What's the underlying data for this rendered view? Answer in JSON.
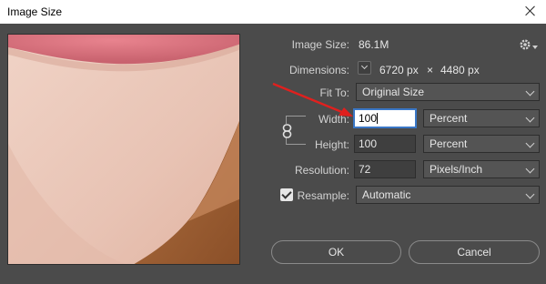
{
  "window": {
    "title": "Image Size"
  },
  "image_size": {
    "label": "Image Size:",
    "value": "86.1M"
  },
  "dimensions": {
    "label": "Dimensions:",
    "width_value": "6720 px",
    "times": "×",
    "height_value": "4480 px"
  },
  "fit_to": {
    "label": "Fit To:",
    "selected": "Original Size"
  },
  "width": {
    "label": "Width:",
    "value": "100",
    "unit": "Percent"
  },
  "height": {
    "label": "Height:",
    "value": "100",
    "unit": "Percent"
  },
  "resolution": {
    "label": "Resolution:",
    "value": "72",
    "unit": "Pixels/Inch"
  },
  "resample": {
    "label": "Resample:",
    "checked": true,
    "selected": "Automatic"
  },
  "buttons": {
    "ok": "OK",
    "cancel": "Cancel"
  },
  "colors": {
    "dialog_bg": "#4b4b4b",
    "annotation_arrow": "#e0201e",
    "focus_border": "#3a77c6"
  },
  "icons": [
    "close-icon",
    "gear-icon",
    "chain-link-icon",
    "chevron-down-icon",
    "checkmark-icon"
  ]
}
